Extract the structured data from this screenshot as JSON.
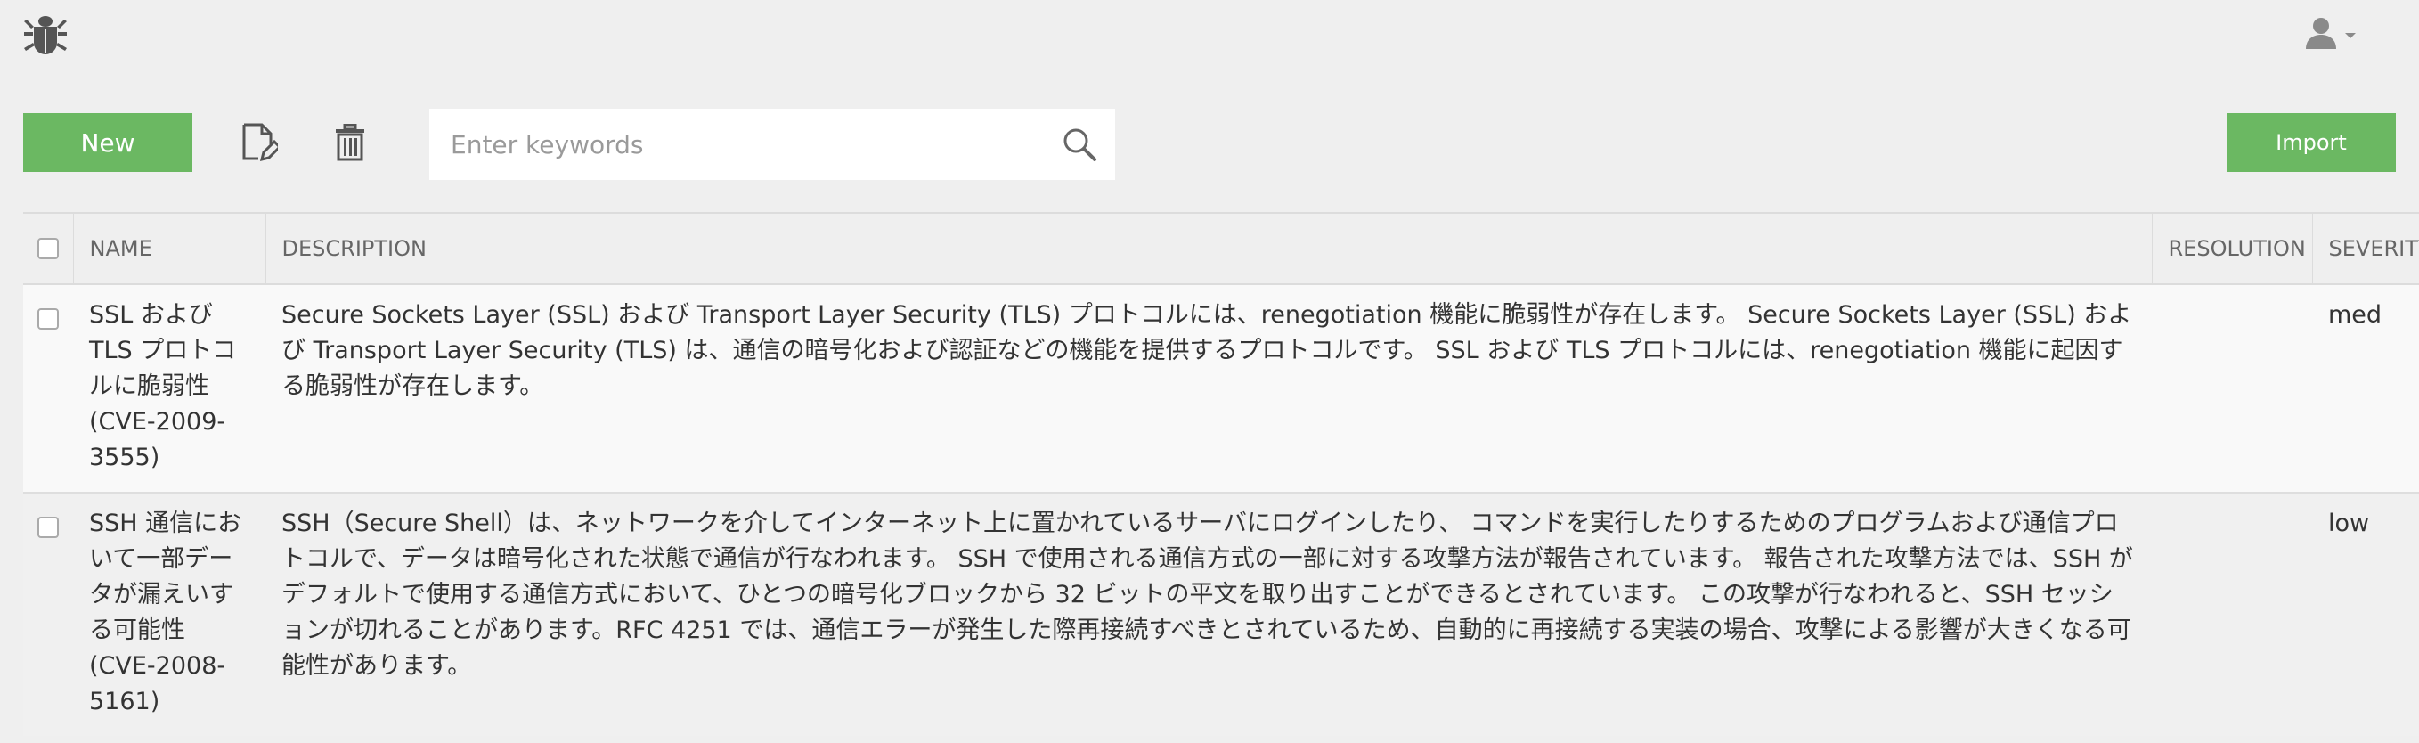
{
  "header": {
    "logo_icon": "bug-icon",
    "user_icon": "user-icon",
    "user_menu_caret": "caret-down-icon"
  },
  "toolbar": {
    "new_label": "New",
    "edit_icon": "edit-document-icon",
    "delete_icon": "trash-icon",
    "import_label": "Import",
    "accent_color": "#6bb862"
  },
  "search": {
    "placeholder": "Enter keywords",
    "value": "",
    "icon": "search-icon"
  },
  "table": {
    "columns": [
      "NAME",
      "DESCRIPTION",
      "RESOLUTION",
      "SEVERITY"
    ],
    "rows": [
      {
        "name": "SSL および TLS プロトコルに脆弱性 (CVE-2009-3555)",
        "description": "Secure Sockets Layer (SSL) および Transport Layer Security (TLS) プロトコルには、renegotiation 機能に脆弱性が存在します。 Secure Sockets Layer (SSL) および Transport Layer Security (TLS) は、通信の暗号化および認証などの機能を提供するプロトコルです。 SSL および TLS プロトコルには、renegotiation 機能に起因する脆弱性が存在します。",
        "resolution": "",
        "severity": "med"
      },
      {
        "name": "SSH 通信において一部データが漏えいする可能性 (CVE-2008-5161)",
        "description": "SSH（Secure Shell）は、ネットワークを介してインターネット上に置かれているサーバにログインしたり、 コマンドを実行したりするためのプログラムおよび通信プロトコルで、データは暗号化された状態で通信が行なわれます。 SSH で使用される通信方式の一部に対する攻撃方法が報告されています。 報告された攻撃方法では、SSH がデフォルトで使用する通信方式において、ひとつの暗号化ブロックから 32 ビットの平文を取り出すことができるとされています。 この攻撃が行なわれると、SSH セッションが切れることがあります。RFC 4251 では、通信エラーが発生した際再接続すべきとされているため、自動的に再接続する実装の場合、攻撃による影響が大きくなる可能性があります。",
        "resolution": "",
        "severity": "low"
      }
    ]
  }
}
